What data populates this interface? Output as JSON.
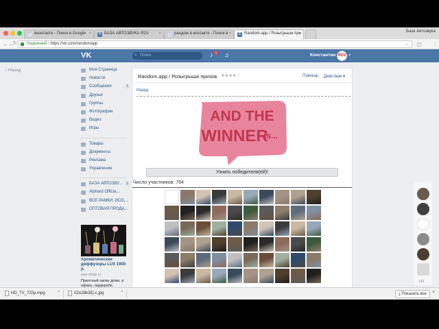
{
  "browser": {
    "profile_name": "База Автозвука",
    "tabs": [
      {
        "title": "вконтакте - Поиск в Google",
        "favicon": "google-icon",
        "active": false
      },
      {
        "title": "БАЗА АВТОЗВУКА R2V",
        "favicon": "vk-icon",
        "active": false
      },
      {
        "title": "рандом в контакте - Поиск в",
        "favicon": "google-icon",
        "active": false
      },
      {
        "title": "Random.app / Розыгрыши при",
        "favicon": "vk-icon",
        "active": true
      }
    ],
    "address": {
      "secure_label": "Надежный",
      "url": "https://vk.com/randomapp"
    }
  },
  "vk_header": {
    "logo": "VK",
    "search_placeholder": "Поиск",
    "notification_count": "1",
    "user_name": "Константин",
    "avatar_text": "R2V"
  },
  "left": {
    "back_label": "Назад"
  },
  "sidebar": {
    "main_items": [
      {
        "label": "Моя Страница",
        "icon": "home-icon",
        "count": ""
      },
      {
        "label": "Новости",
        "icon": "news-icon",
        "count": ""
      },
      {
        "label": "Сообщения",
        "icon": "messages-icon",
        "count": "1"
      },
      {
        "label": "Друзья",
        "icon": "friends-icon",
        "count": ""
      },
      {
        "label": "Группы",
        "icon": "groups-icon",
        "count": ""
      },
      {
        "label": "Фотографии",
        "icon": "photos-icon",
        "count": ""
      },
      {
        "label": "Видео",
        "icon": "video-icon",
        "count": ""
      },
      {
        "label": "Игры",
        "icon": "games-icon",
        "count": ""
      }
    ],
    "tools_items": [
      {
        "label": "Товары",
        "icon": "goods-icon"
      },
      {
        "label": "Документы",
        "icon": "documents-icon"
      },
      {
        "label": "Реклама",
        "icon": "ads-icon"
      },
      {
        "label": "Управление",
        "icon": "manage-icon"
      }
    ],
    "group_items": [
      {
        "label": "БАЗА АВТОЗВУ...",
        "count": "1"
      },
      {
        "label": "Alphard Officia...",
        "count": ""
      },
      {
        "label": "ВСЕ РАМКИ, ИСО,...",
        "count": ""
      },
      {
        "label": "ОПТОВАЯ ПРОДА...",
        "count": ""
      }
    ]
  },
  "ad": {
    "title": "Ароматические диффузоры LUX 1900 р.",
    "host": "uao-shop.ru",
    "text": "Приятный запах дома, в офисе, гардеробе."
  },
  "app": {
    "title": "Random.app / Розыгрыши призов",
    "rating": "★★★★☆",
    "help_link": "Помощь",
    "actions_link": "Действия",
    "back_link": "Назад",
    "banner_line1": "AND THE",
    "banner_line2": "WINNER",
    "banner_suffix": "is...",
    "find_button": "Узнать победителя(ей)!",
    "participants_label": "Число участников: 784"
  },
  "right_rail": {
    "count": "143"
  },
  "downloads": {
    "items": [
      {
        "name": "HD_TV_720p.mpg"
      },
      {
        "name": "0Ze28k3Ej-c.jpg"
      }
    ],
    "show_all": "Показать все"
  },
  "colors": {
    "vk_blue": "#4a76a8",
    "link_blue": "#2a5885",
    "banner_pink": "#e9849d",
    "banner_text": "#c0394f",
    "page_bg": "#edeef0"
  }
}
